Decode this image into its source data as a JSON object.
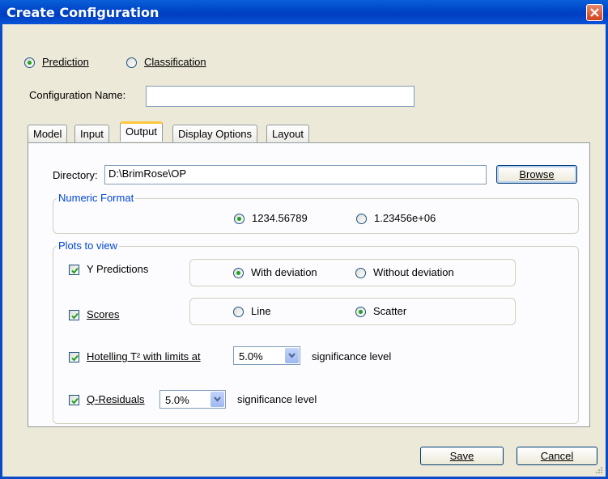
{
  "window": {
    "title": "Create Configuration",
    "close_icon": "close-icon"
  },
  "mode": {
    "prediction_label": "Prediction",
    "classification_label": "Classification",
    "selected": "Prediction"
  },
  "config_name": {
    "label": "Configuration Name:",
    "value": ""
  },
  "tabs": [
    {
      "label": "Model"
    },
    {
      "label": "Input"
    },
    {
      "label": "Output",
      "active": true
    },
    {
      "label": "Display Options"
    },
    {
      "label": "Layout"
    }
  ],
  "output": {
    "directory_label": "Directory:",
    "directory_value": "D:\\BrimRose\\OP",
    "browse_label": "Browse",
    "numeric_format": {
      "legend": "Numeric Format",
      "option1": "1234.56789",
      "option2": "1.23456e+06",
      "selected": "1234.56789"
    },
    "plots": {
      "legend": "Plots to view",
      "y_predictions": {
        "label": "Y Predictions",
        "checked": true,
        "opt1": "With deviation",
        "opt2": "Without deviation",
        "selected": "With deviation"
      },
      "scores": {
        "label": "Scores",
        "checked": true,
        "opt1": "Line",
        "opt2": "Scatter",
        "selected": "Scatter"
      },
      "hotelling": {
        "label": "Hotelling T² with limits at",
        "checked": true,
        "value": "5.0%",
        "suffix": "significance level"
      },
      "q_residuals": {
        "label": "Q-Residuals",
        "checked": true,
        "value": "5.0%",
        "suffix": "significance level"
      }
    }
  },
  "buttons": {
    "save": "Save",
    "cancel": "Cancel"
  },
  "colors": {
    "title_bar": "#0047c9",
    "dialog_bg": "#ece9d8",
    "group_legend": "#0046d5",
    "radio_dot": "#21a121"
  }
}
